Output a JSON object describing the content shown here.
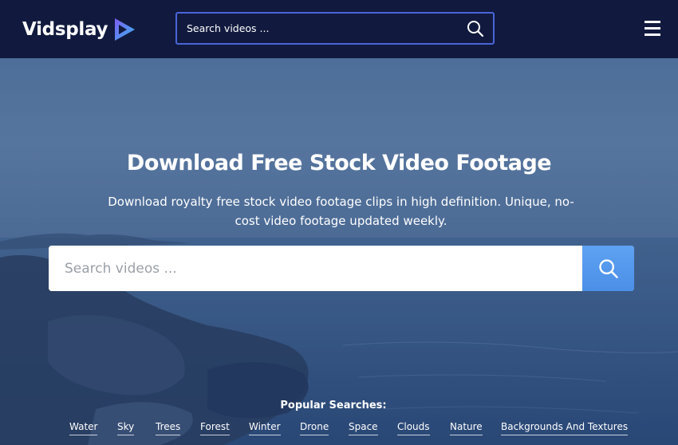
{
  "header": {
    "logo_text": "Vidsplay",
    "search_placeholder": "Search videos ...",
    "menu_icon": "hamburger-menu-icon",
    "search_icon": "search-icon"
  },
  "hero": {
    "title": "Download Free Stock Video Footage",
    "subtitle": "Download royalty free stock video footage clips in high definition. Unique, no-cost video footage updated weekly.",
    "search_placeholder": "Search videos ...",
    "search_icon": "search-icon"
  },
  "popular": {
    "title": "Popular Searches:",
    "tags": [
      "Water",
      "Sky",
      "Trees",
      "Forest",
      "Winter",
      "Drone",
      "Space",
      "Clouds",
      "Nature",
      "Backgrounds And Textures"
    ]
  },
  "colors": {
    "header_bg": "#111a3e",
    "search_border": "#4a64d8",
    "search_button": "#4b8fe8",
    "text": "#ffffff"
  }
}
